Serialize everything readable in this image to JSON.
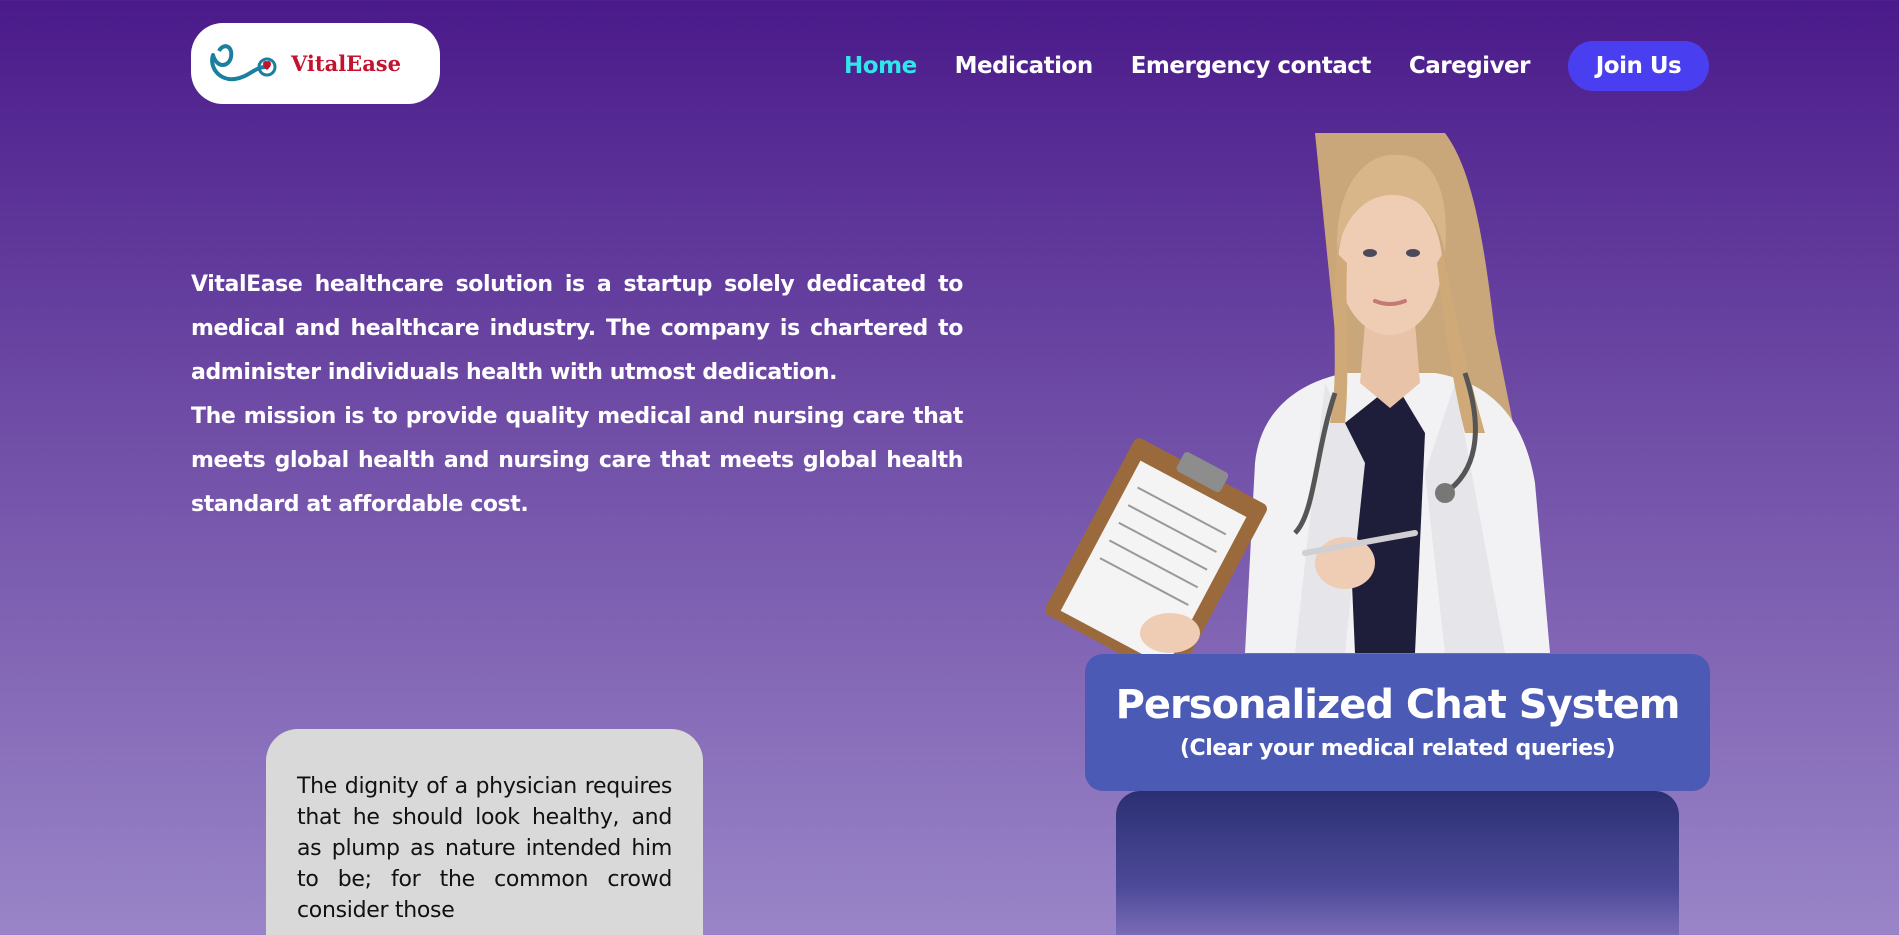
{
  "logo": {
    "text": "VitalEase",
    "icon": "stethoscope-heart-icon"
  },
  "nav": {
    "links": [
      {
        "label": "Home",
        "active": true
      },
      {
        "label": "Medication",
        "active": false
      },
      {
        "label": "Emergency contact",
        "active": false
      },
      {
        "label": "Caregiver",
        "active": false
      }
    ],
    "join_label": "Join Us"
  },
  "intro": {
    "paragraph1": "VitalEase healthcare solution is a startup solely dedicated to medical and healthcare industry. The company is chartered to administer individuals health with utmost dedication.",
    "paragraph2": "The mission is to provide quality medical and nursing care that meets global health and nursing care that meets global health standard at affordable cost."
  },
  "hero_image": {
    "subject": "doctor-with-clipboard"
  },
  "chat": {
    "title": "Personalized Chat System",
    "subtitle": "(Clear your medical related queries)"
  },
  "quote": {
    "text": "The dignity of a physician requires that he should look healthy, and as plump as nature intended him to be; for the common crowd consider those"
  },
  "colors": {
    "accent_active": "#2fe6ea",
    "join_button": "#4a3ff0",
    "chat_card": "#4a5ab5",
    "logo_red": "#c4122f"
  }
}
